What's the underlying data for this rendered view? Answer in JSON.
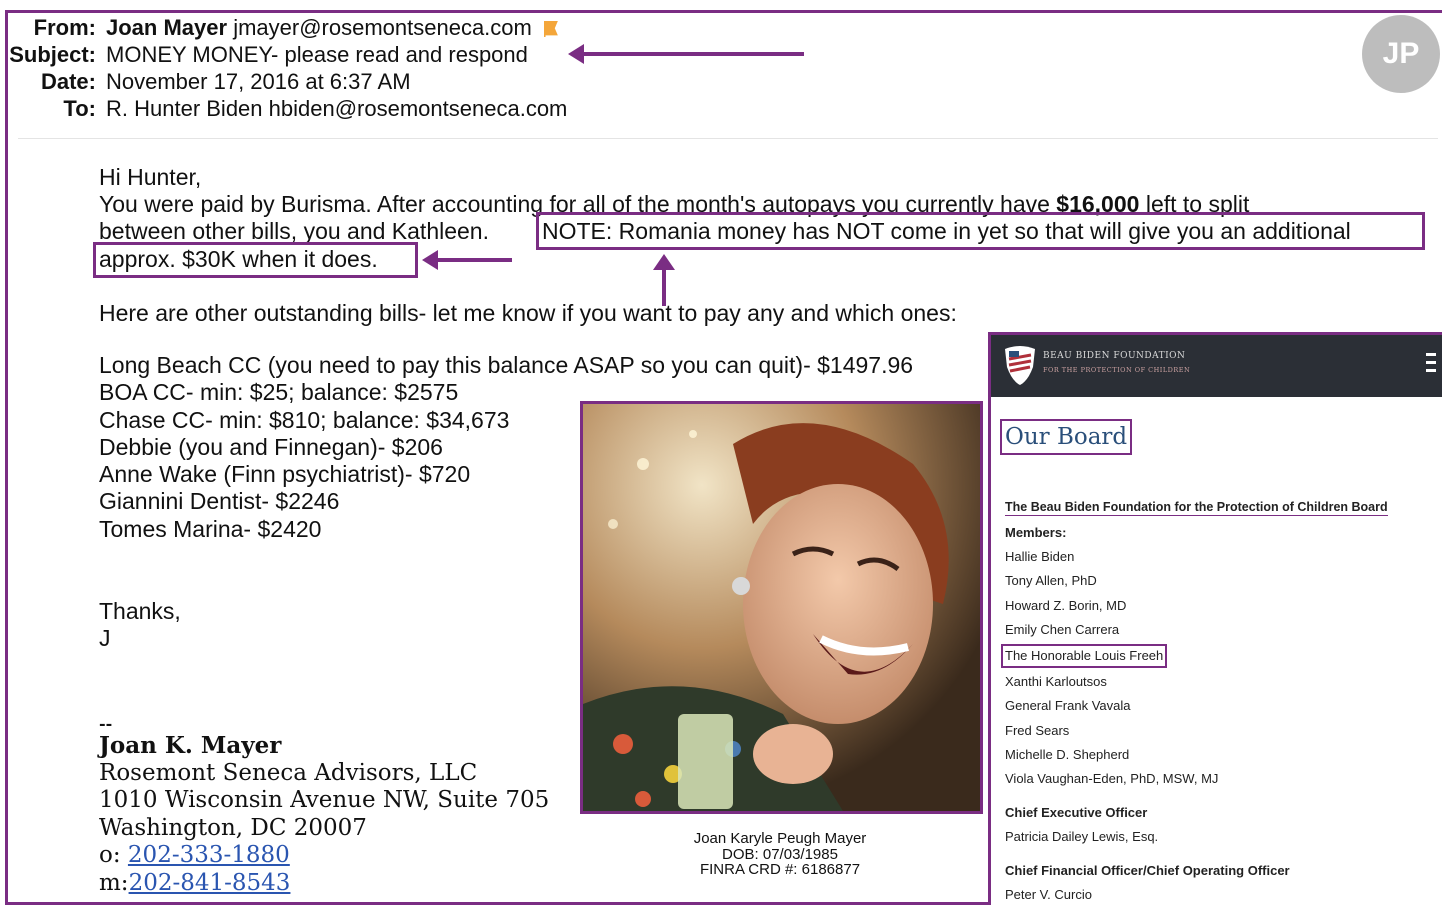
{
  "header": {
    "from_label": "From:",
    "from_name": "Joan Mayer",
    "from_email": "jmayer@rosemontseneca.com",
    "subject_label": "Subject:",
    "subject": "MONEY MONEY- please read and respond",
    "date_label": "Date:",
    "date": "November 17, 2016 at 6:37 AM",
    "to_label": "To:",
    "to_name": "R. Hunter Biden",
    "to_email": "hbiden@rosemontseneca.com",
    "avatar_initials": "JP"
  },
  "body": {
    "greeting": "Hi Hunter,",
    "p1a": "You were paid by Burisma. After accounting for all of the month's autopays you currently have ",
    "p1_amount": "$16,000",
    "p1b": " left to split",
    "p2": "between other bills, you and Kathleen.",
    "note": "NOTE: Romania money has NOT come in yet so that will give you an additional",
    "p3": "approx. $30K when it does.",
    "bills_intro": "Here are other outstanding bills- let me know if you want to pay any and which ones:",
    "bills": [
      "Long Beach CC (you need to pay this balance ASAP so you can quit)- $1497.96",
      "BOA CC- min: $25; balance: $2575",
      "Chase CC- min: $810; balance: $34,673",
      "Debbie (you and Finnegan)- $206",
      "Anne Wake (Finn psychiatrist)- $720",
      "Giannini Dentist- $2246",
      "Tomes Marina- $2420"
    ],
    "thanks": "Thanks,",
    "initial": "J"
  },
  "signature": {
    "dashes": "--",
    "name": "Joan K. Mayer",
    "company": "Rosemont Seneca Advisors, LLC",
    "address1": "1010 Wisconsin Avenue NW, Suite 705",
    "address2": "Washington, DC 20007",
    "office_label": "o: ",
    "office_phone": "202-333-1880",
    "mobile_label": "m:",
    "mobile_phone": "202-841-8543"
  },
  "photo_caption": {
    "line1": "Joan Karyle Peugh Mayer",
    "line2": "DOB: 07/03/1985",
    "line3": "FINRA CRD #: 6186877"
  },
  "website": {
    "logo_title": "BEAU BIDEN FOUNDATION",
    "logo_sub": "FOR THE PROTECTION OF CHILDREN",
    "page_title": "Our Board",
    "board_heading": "The Beau Biden Foundation for the Protection of Children Board",
    "members_label": "Members:",
    "members": [
      "Hallie Biden",
      "Tony Allen, PhD",
      "Howard Z. Borin, MD",
      "Emily Chen Carrera",
      "The Honorable Louis Freeh",
      "Xanthi Karloutsos",
      "General Frank Vavala",
      "Fred Sears",
      "Michelle D. Shepherd",
      "Viola Vaughan-Eden, PhD, MSW, MJ"
    ],
    "ceo_label": "Chief Executive Officer",
    "ceo": "Patricia Dailey Lewis, Esq.",
    "cfo_label": "Chief Financial Officer/Chief Operating Officer",
    "cfo": "Peter V. Curcio"
  },
  "colors": {
    "accent": "#7a2d83",
    "link": "#2a55b0",
    "site_bar": "#2b2f36",
    "site_title": "#2a4f7a"
  }
}
